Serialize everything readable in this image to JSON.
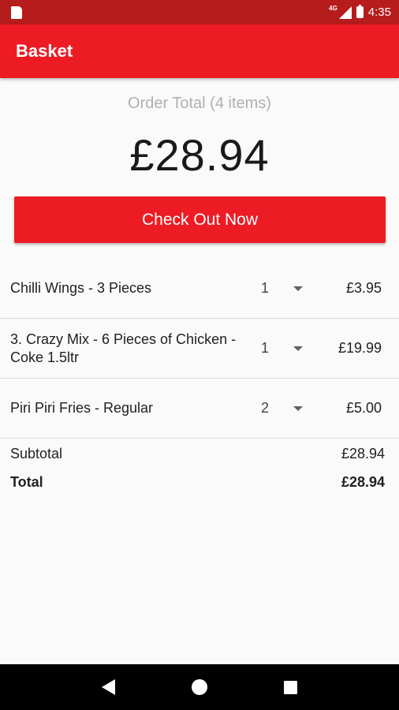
{
  "status_bar": {
    "network": "4G",
    "time": "4:35"
  },
  "app_bar": {
    "title": "Basket"
  },
  "order_summary": {
    "label": "Order Total (4 items)",
    "amount": "£28.94"
  },
  "checkout_button": {
    "label": "Check Out Now"
  },
  "items": [
    {
      "name": "Chilli Wings - 3 Pieces",
      "quantity": "1",
      "price": "£3.95"
    },
    {
      "name": "3. Crazy Mix - 6 Pieces of Chicken - Coke 1.5ltr",
      "quantity": "1",
      "price": "£19.99"
    },
    {
      "name": "Piri Piri Fries - Regular",
      "quantity": "2",
      "price": "£5.00"
    }
  ],
  "totals": {
    "subtotal_label": "Subtotal",
    "subtotal_value": "£28.94",
    "total_label": "Total",
    "total_value": "£28.94"
  },
  "colors": {
    "status_bar": "#b71c1c",
    "accent": "#ed1c24"
  },
  "icons": {
    "status_left": "sim-card-icon",
    "signal": "cell-signal-icon",
    "battery": "battery-icon",
    "nav": [
      "back-icon",
      "home-icon",
      "recents-icon"
    ]
  }
}
